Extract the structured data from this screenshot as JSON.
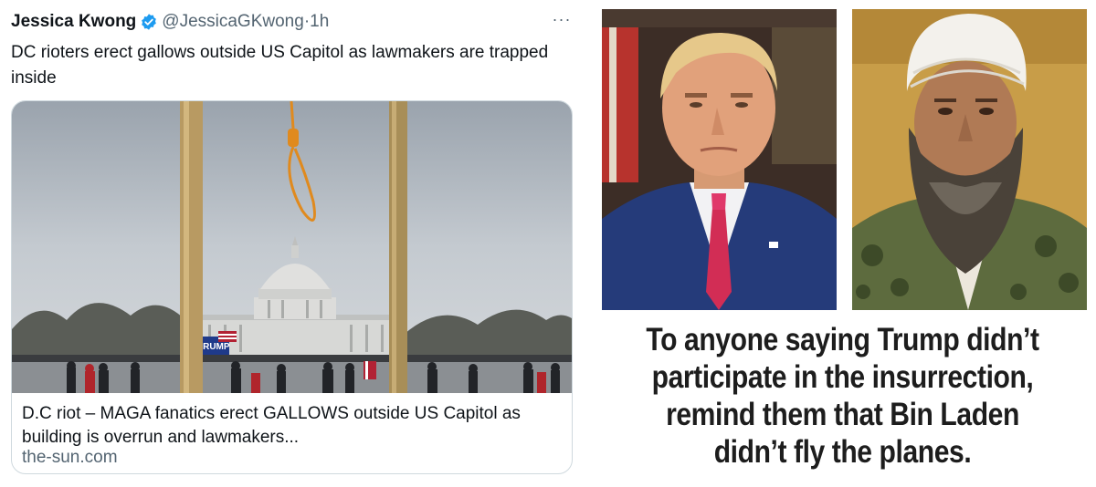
{
  "tweet": {
    "author_name": "Jessica Kwong",
    "author_handle": "@JessicaGKwong",
    "separator": "·",
    "time": "1h",
    "more_label": "···",
    "text": "DC rioters erect gallows outside US Capitol as lawmakers are trapped inside",
    "card": {
      "title": "D.C riot – MAGA fanatics erect GALLOWS outside US Capitol as building is overrun and lawmakers...",
      "domain": "the-sun.com",
      "sign_text": "TRUMP"
    },
    "colors": {
      "text": "#0f1419",
      "secondary": "#536471",
      "verified": "#1d9bf0",
      "border": "#cfd9de"
    }
  },
  "meme": {
    "caption_lines": [
      "To anyone saying Trump didn’t",
      "participate in the insurrection,",
      "remind them that Bin Laden",
      "didn’t fly the planes."
    ]
  }
}
